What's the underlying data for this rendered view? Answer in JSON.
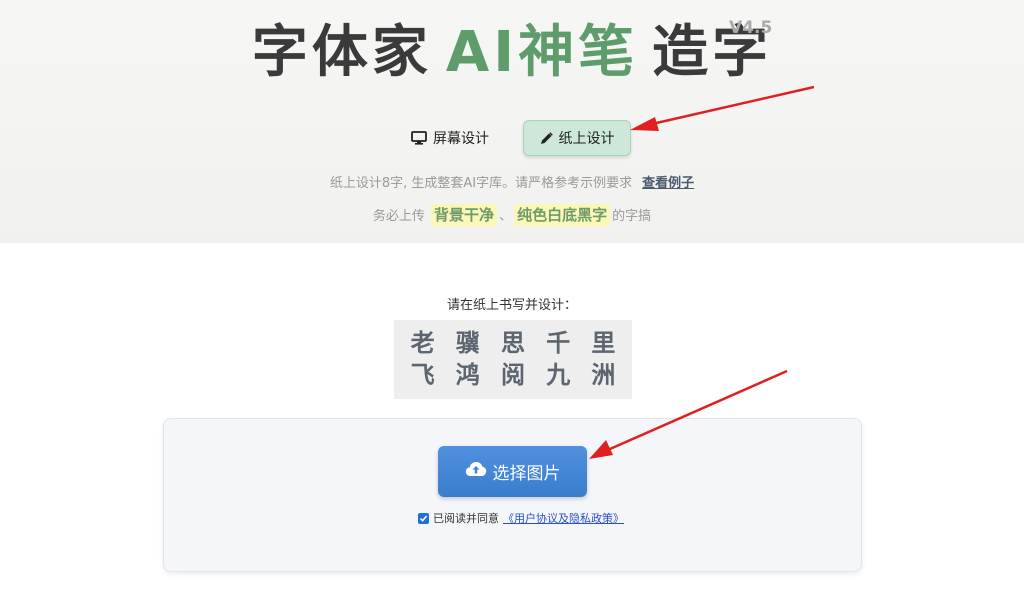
{
  "header": {
    "title_part1": "字体家",
    "title_ai": "AI神笔",
    "title_part2": "造字",
    "version": "V4.5"
  },
  "colors": {
    "accent_green": "#5e9c6c",
    "selected_tab_bg": "#cde8d8",
    "upload_button": "#3f85d6",
    "highlight_bg": "#fbf7b8",
    "arrow_red": "#e02020"
  },
  "tabs": [
    {
      "icon": "monitor-icon",
      "label": "屏幕设计",
      "selected": false
    },
    {
      "icon": "pencil-icon",
      "label": "纸上设计",
      "selected": true
    }
  ],
  "description": {
    "text": "纸上设计8字, 生成整套AI字库。请严格参考示例要求",
    "link": "查看例子"
  },
  "warning": {
    "prefix": "务必上传",
    "highlight1": "背景干净",
    "separator": "、",
    "highlight2": "纯色白底黑字",
    "suffix": "的字搞"
  },
  "write_prompt": "请在纸上书写并设计：",
  "sample_chars": [
    "老",
    "骥",
    "思",
    "千",
    "里",
    "飞",
    "鸿",
    "阅",
    "九",
    "洲"
  ],
  "upload": {
    "button_icon": "cloud-upload-icon",
    "button_label": "选择图片",
    "agree_checked": true,
    "agree_text": "已阅读并同意",
    "agree_link": "《用户协议及隐私政策》"
  }
}
